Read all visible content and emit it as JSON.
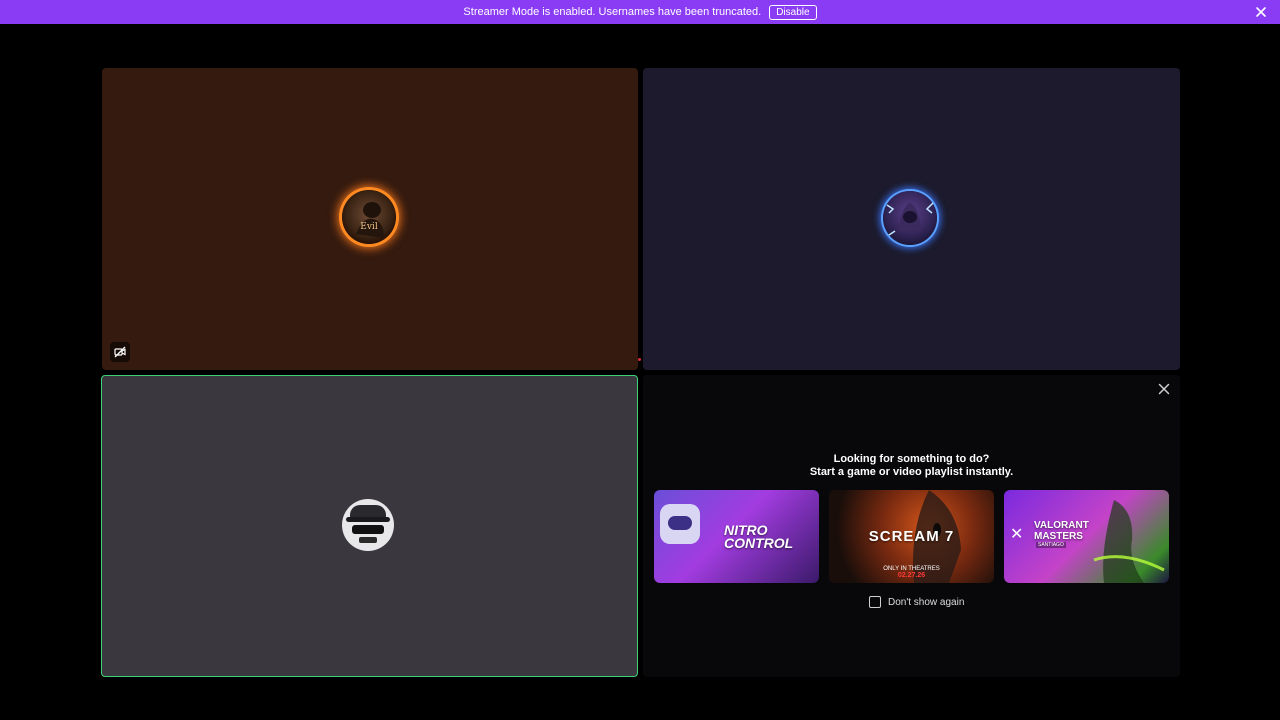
{
  "banner": {
    "message": "Streamer Mode is enabled. Usernames have been truncated.",
    "disable_label": "Disable",
    "close_icon": "close-icon",
    "color": "#8a3cf5"
  },
  "tiles": [
    {
      "background": "#341a0f",
      "avatar_text": "Evil",
      "status_icon": "muted-camera-icon"
    },
    {
      "background": "#1c1a2c"
    },
    {
      "background": "#3a383e",
      "speaking": true,
      "border_color": "#3ed27a"
    }
  ],
  "promo": {
    "close_icon": "close-icon",
    "heading_line1": "Looking for something to do?",
    "heading_line2": "Start a game or video playlist instantly.",
    "cards": [
      {
        "title": "NITRO CONTROL"
      },
      {
        "title": "SCREAM 7",
        "subtitle": "ONLY IN THEATRES",
        "date": "02.27.26"
      },
      {
        "title_line1": "VALORANT",
        "title_line2": "MASTERS",
        "subtitle": "SANTIAGO"
      }
    ],
    "dont_show_again_label": "Don't show again",
    "dont_show_again_checked": false
  }
}
